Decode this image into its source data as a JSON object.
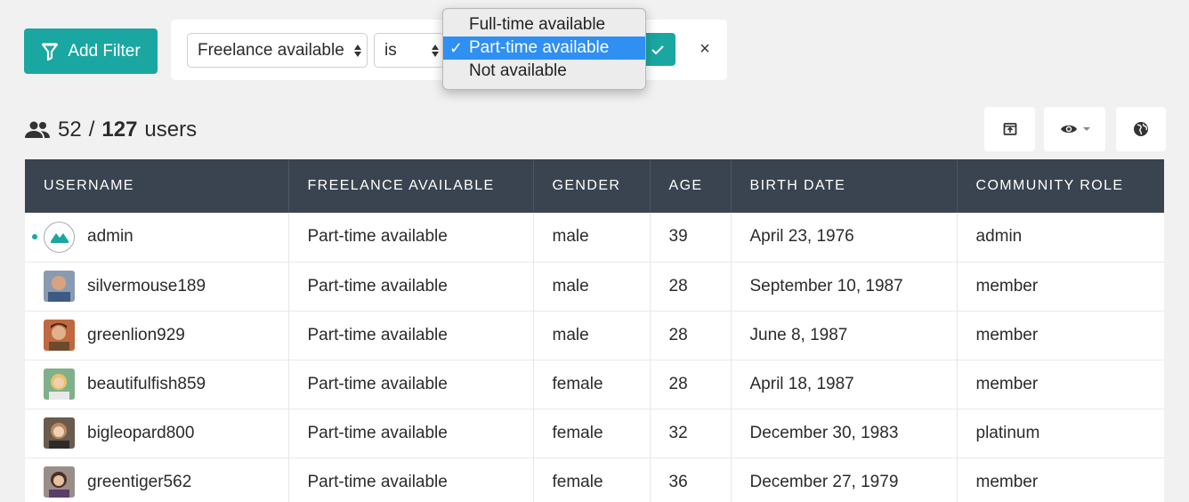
{
  "toolbar": {
    "add_filter_label": "Add Filter"
  },
  "filter": {
    "field_value": "Freelance available",
    "operator_value": "is",
    "options": [
      {
        "label": "Full-time available",
        "selected": false
      },
      {
        "label": "Part-time available",
        "selected": true
      },
      {
        "label": "Not available",
        "selected": false
      }
    ],
    "check_mark": "✓",
    "close_label": "×"
  },
  "summary": {
    "shown": "52",
    "separator": "/",
    "total": "127",
    "unit": "users"
  },
  "icons": {
    "filter": "funnel-icon",
    "apply": "checkmark-icon",
    "users": "users-icon",
    "export": "export-icon",
    "view": "eye-icon",
    "globe": "globe-icon"
  },
  "colors": {
    "accent": "#1aa7a1",
    "header_bg": "#3a4450",
    "dropdown_selected": "#2f8ff3"
  },
  "table": {
    "columns": [
      "USERNAME",
      "FREELANCE AVAILABLE",
      "GENDER",
      "AGE",
      "BIRTH DATE",
      "COMMUNITY ROLE"
    ],
    "rows": [
      {
        "username": "admin",
        "freelance": "Part-time available",
        "gender": "male",
        "age": "39",
        "birth": "April 23, 1976",
        "role": "admin"
      },
      {
        "username": "silvermouse189",
        "freelance": "Part-time available",
        "gender": "male",
        "age": "28",
        "birth": "September 10, 1987",
        "role": "member"
      },
      {
        "username": "greenlion929",
        "freelance": "Part-time available",
        "gender": "male",
        "age": "28",
        "birth": "June 8, 1987",
        "role": "member"
      },
      {
        "username": "beautifulfish859",
        "freelance": "Part-time available",
        "gender": "female",
        "age": "28",
        "birth": "April 18, 1987",
        "role": "member"
      },
      {
        "username": "bigleopard800",
        "freelance": "Part-time available",
        "gender": "female",
        "age": "32",
        "birth": "December 30, 1983",
        "role": "platinum"
      },
      {
        "username": "greentiger562",
        "freelance": "Part-time available",
        "gender": "female",
        "age": "36",
        "birth": "December 27, 1979",
        "role": "member"
      }
    ]
  }
}
